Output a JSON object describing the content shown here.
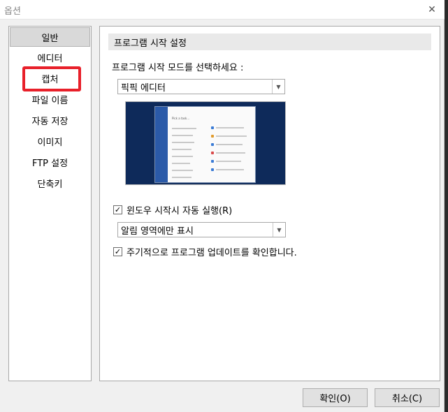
{
  "window": {
    "title": "옵션"
  },
  "sidebar": {
    "items": [
      {
        "label": "일반"
      },
      {
        "label": "에디터"
      },
      {
        "label": "캡처"
      },
      {
        "label": "파일 이름"
      },
      {
        "label": "자동 저장"
      },
      {
        "label": "이미지"
      },
      {
        "label": "FTP 설정"
      },
      {
        "label": "단축키"
      }
    ],
    "active_index": 0,
    "highlighted_index": 2
  },
  "main": {
    "section_title": "프로그램 시작 설정",
    "mode_label": "프로그램 시작 모드를 선택하세요 :",
    "mode_select": {
      "value": "픽픽 에디터"
    },
    "preview_window": {
      "title": "Pick a task..."
    },
    "autostart": {
      "label": "윈도우 시작시 자동 실행(R)",
      "checked": true
    },
    "notify_select": {
      "value": "알림 영역에만 표시"
    },
    "update_check": {
      "label": "주기적으로 프로그램 업데이트를 확인합니다.",
      "checked": true
    }
  },
  "buttons": {
    "ok": "확인(O)",
    "cancel": "취소(C)"
  },
  "colors": {
    "highlight": "#e8202a",
    "preview_bg": "#0e2a5a",
    "preview_sidebar": "#2b5aa8"
  }
}
